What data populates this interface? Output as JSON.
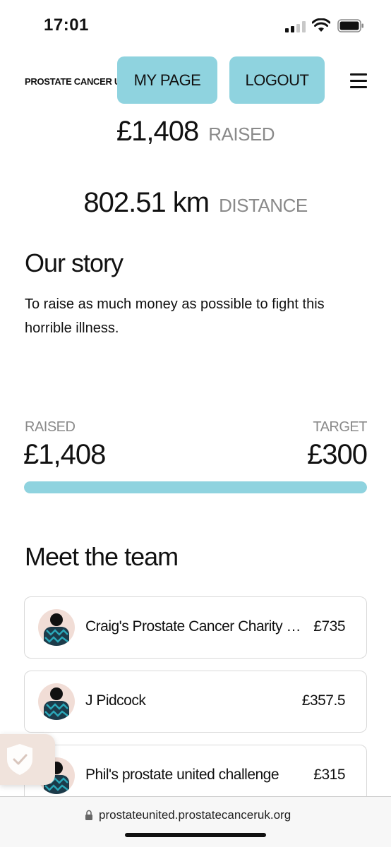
{
  "status_bar": {
    "time": "17:01"
  },
  "header": {
    "brand": "PROSTATE CANCER UK",
    "my_page_label": "MY PAGE",
    "logout_label": "LOGOUT",
    "menu_icon": "hamburger-menu-icon"
  },
  "stats": {
    "raised_value": "£1,408",
    "raised_label": "RAISED",
    "distance_value": "802.51 km",
    "distance_label": "DISTANCE"
  },
  "story": {
    "title": "Our story",
    "text": "To raise as much money as possible to fight this horrible illness."
  },
  "progress": {
    "raised_label": "RAISED",
    "raised_value": "£1,408",
    "target_label": "TARGET",
    "target_value": "£300",
    "fill_percent": 100
  },
  "team": {
    "title": "Meet the team",
    "members": [
      {
        "name": "Craig's Prostate Cancer Charity Challenge",
        "amount": "£735"
      },
      {
        "name": "J Pidcock",
        "amount": "£357.5"
      },
      {
        "name": "Phil's prostate united challenge",
        "amount": "£315"
      }
    ]
  },
  "browser": {
    "url": "prostateunited.prostatecanceruk.org"
  },
  "colors": {
    "accent": "#8fd3df",
    "muted": "#8a8a8a",
    "avatar_bg": "#f1ddd6"
  }
}
